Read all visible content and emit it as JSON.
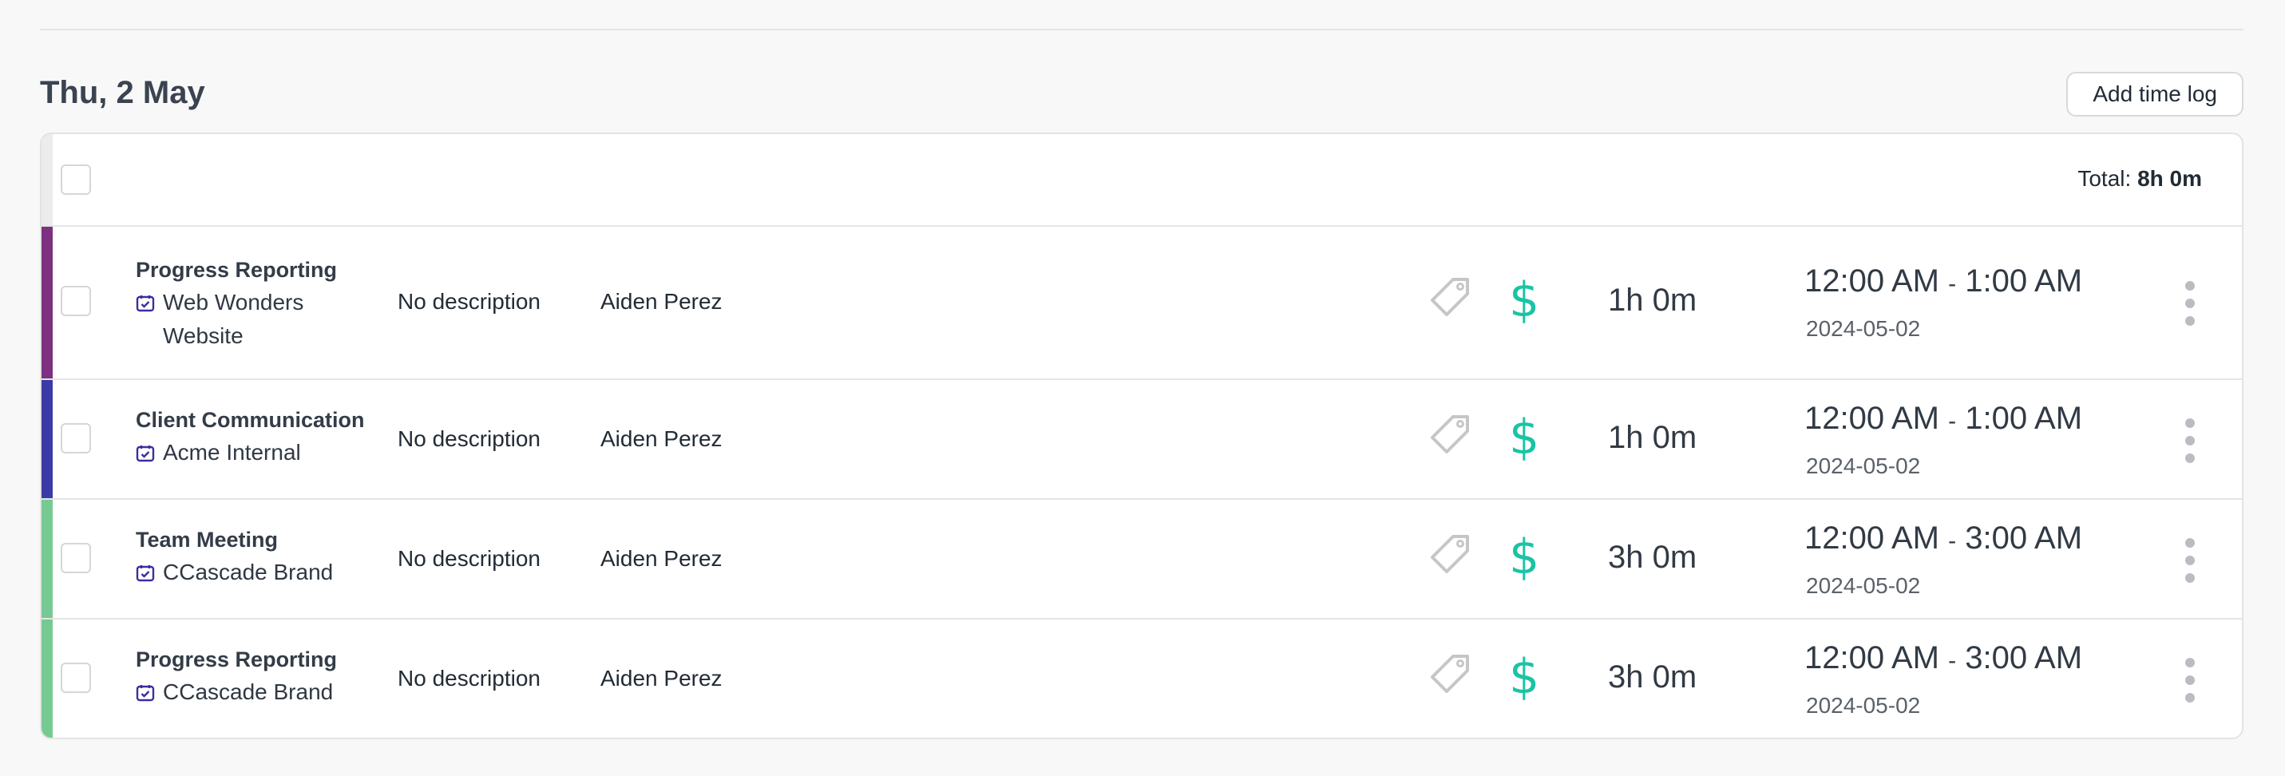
{
  "day": {
    "title": "Thu, 2 May",
    "add_button": "Add time log"
  },
  "summary": {
    "total_label": "Total:",
    "total_value": "8h 0m"
  },
  "colors": {
    "billable": "#1bc3a6",
    "project_icon": "#3a2fa0"
  },
  "icons": {
    "tag": "tag-icon",
    "billable": "dollar-icon",
    "project": "calendar-check-icon",
    "menu": "more-vertical-icon"
  },
  "entries": [
    {
      "color": "#7d2f80",
      "task": "Progress Reporting",
      "project": "Web Wonders Website",
      "description": "No description",
      "user": "Aiden Perez",
      "billable_symbol": "$",
      "duration": "1h 0m",
      "start": "12:00 AM",
      "separator": "-",
      "end": "1:00 AM",
      "date": "2024-05-02"
    },
    {
      "color": "#3c3aa6",
      "task": "Client Communication",
      "project": "Acme Internal",
      "description": "No description",
      "user": "Aiden Perez",
      "billable_symbol": "$",
      "duration": "1h 0m",
      "start": "12:00 AM",
      "separator": "-",
      "end": "1:00 AM",
      "date": "2024-05-02"
    },
    {
      "color": "#76c993",
      "task": "Team Meeting",
      "project": "CCascade Brand",
      "description": "No description",
      "user": "Aiden Perez",
      "billable_symbol": "$",
      "duration": "3h 0m",
      "start": "12:00 AM",
      "separator": "-",
      "end": "3:00 AM",
      "date": "2024-05-02"
    },
    {
      "color": "#76c993",
      "task": "Progress Reporting",
      "project": "CCascade Brand",
      "description": "No description",
      "user": "Aiden Perez",
      "billable_symbol": "$",
      "duration": "3h 0m",
      "start": "12:00 AM",
      "separator": "-",
      "end": "3:00 AM",
      "date": "2024-05-02"
    }
  ]
}
